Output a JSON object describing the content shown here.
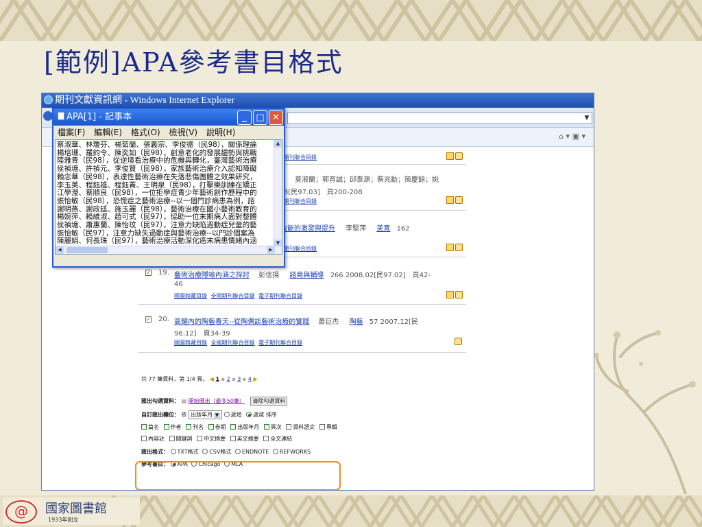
{
  "slide": {
    "title": "[範例]APA參考書目格式"
  },
  "browser": {
    "title": "期刊文獻資訊網 - Windows Internet Explorer"
  },
  "notepad": {
    "title": "APA[1] - 記事本",
    "menu": [
      "檔案(F)",
      "編輯(E)",
      "格式(O)",
      "檢視(V)",
      "說明(H)"
    ],
    "lines": [
      "蔡淑華、林瓊芬、楊茹蘭、張義宗、李俊德（民98），關係理論",
      "楊培珊、羅鈞令、陳奕如（民98），創意老化的發展趨勢與挑戰",
      "陸雅青（民98），從逆境看治療中的危機與轉化，臺灣藝術治療",
      "侯禎塘、許禎元、李俊賢（民98），家族藝術治療介入認知障礙",
      "賴念華（民98），表達性藝術治療在失落悲傷團體之效果研究，",
      "李玉美、程鈺雄、程鈺菁、王明泉（民98），打擊樂訓練在矯正",
      "江學瀅、蔡順良（民98），一位拒學症青少年藝術創作歷程中的",
      "張怡敏（民98），恐慌症之藝術治療--以一個門診病患為例，諮",
      "謝明燕、謝政廷、施玉麗（民98），藝術治療在國小藝術教育的",
      "楊婉萍、賴維淑、趙可式（民97），協助一位末期病人面對整體",
      "侯禎塘、蕭惠蘭、陳怡玟（民97），注意力缺陷過動症兒童的藝",
      "張怡敏（民97），注意力缺失過動症與藝術治療--以門診個案為",
      "陳麗娟、何長珠（民97），藝術治療活動深化癌末病患情緒內涵"
    ]
  },
  "results": {
    "top_links": "子期刊聯合目錄",
    "rec_partial": {
      "authors": "莫淑蘭；郭育誠；邱泰源；蔡兆勳；陳慶餘；姚",
      "meta": "3[民97.03]　頁200-208",
      "links": "子期刊聯合目錄"
    },
    "rec_partial2": {
      "title": "效能的激發與提升",
      "author": "李堅萍",
      "journal": "美育",
      "meta": "162",
      "links": "子期刊聯合目錄"
    },
    "rec19": {
      "num": "19.",
      "title": "藝術治療隱喻內涵之探討",
      "author": "彭信揚",
      "journal": "諮商與輔導",
      "meta": "266 2008.02[民97.02]　頁42-",
      "meta2": "46",
      "link1": "國圖館藏目錄",
      "link2": "全國期刊聯合目錄",
      "link3": "電子期刊聯合目錄"
    },
    "rec20": {
      "num": "20.",
      "title": "高耀內的陶藝春天--從陶偶談藝術治療的實踐",
      "author": "蕭巨杰",
      "journal": "陶藝",
      "meta": "57 2007.12[民",
      "meta2": "96.12]　頁34-39",
      "link1": "國圖館藏目錄",
      "link2": "全國期刊聯合目錄",
      "link3": "電子期刊聯合目錄"
    },
    "pager": {
      "summary": "共 77 筆資料，第 1/4 頁，",
      "pages": [
        "1",
        "2",
        "3",
        "4"
      ]
    },
    "export": {
      "label": "匯出勾選資料：",
      "link": "開始匯出（最多50筆）",
      "clear": "清除勾選資料"
    },
    "custom": {
      "label": "自訂匯出欄位：",
      "sort_prefix": "依",
      "sort_field": "出版年月",
      "asc": "遞增",
      "desc": "遞減",
      "sort_suffix": "排序"
    },
    "fields_row1": [
      "篇名",
      "作者",
      "刊名",
      "卷期",
      "出版年月",
      "頁次",
      "資料語文",
      "專輯"
    ],
    "fields_row2": [
      "內容註",
      "關鍵詞",
      "中文摘要",
      "英文摘要",
      "全文連結"
    ],
    "format": {
      "label": "匯出格式：",
      "options": [
        "TXT格式",
        "CSV格式",
        "ENDNOTE",
        "REFWORKS"
      ]
    },
    "citation": {
      "label": "參考書目：",
      "options": [
        "APA",
        "Chicago",
        "MLA"
      ]
    }
  },
  "logo": {
    "name": "國家圖書館",
    "year": "1933年創立"
  },
  "colors": {
    "title": "#1a2a8c",
    "highlight": "#f08c1a",
    "ie_title": "#2f63c4"
  }
}
